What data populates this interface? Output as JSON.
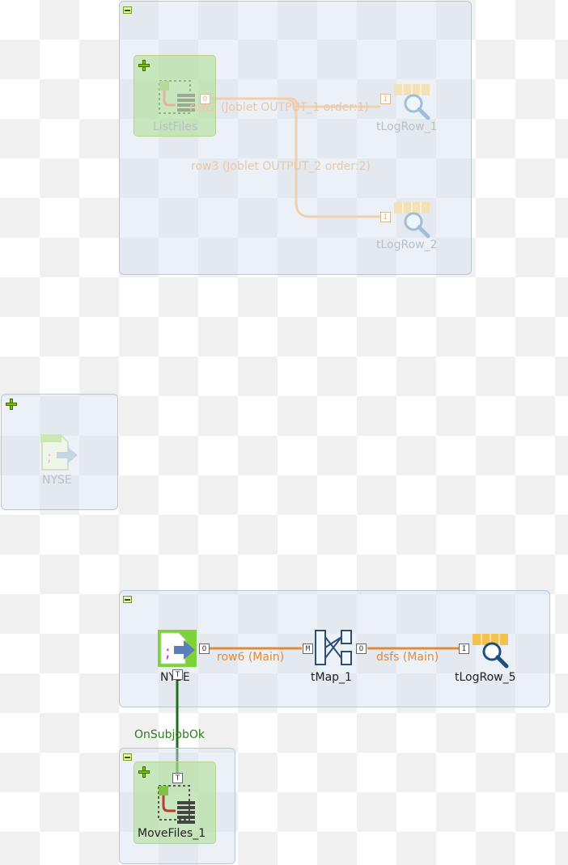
{
  "subjob_top": {
    "joblet": {
      "label": "ListFiles"
    },
    "components": [
      {
        "label": "tLogRow_1"
      },
      {
        "label": "tLogRow_2"
      }
    ],
    "links": [
      {
        "label": "row2 (Joblet OUTPUT_1 order:1)"
      },
      {
        "label": "row3 (Joblet OUTPUT_2 order:2)"
      }
    ]
  },
  "subjob_middle": {
    "component": {
      "label": "NYSE"
    }
  },
  "subjob_main": {
    "components": [
      {
        "label": "NYSE"
      },
      {
        "label": "tMap_1"
      },
      {
        "label": "tLogRow_5"
      }
    ],
    "links": [
      {
        "label": "row6 (Main)"
      },
      {
        "label": "dsfs (Main)"
      }
    ],
    "ports": {
      "output": "O",
      "map": "M",
      "input": "I",
      "trigger": "T"
    }
  },
  "trigger": {
    "label": "OnSubjobOk"
  },
  "subjob_bottom": {
    "component": {
      "label": "MoveFiles_1"
    }
  },
  "colors": {
    "main_link": "#e08a3a",
    "trigger_link": "#1f6e1f",
    "subjob_fill": "#d2e1ee",
    "joblet_fill": "#a0dc78"
  }
}
